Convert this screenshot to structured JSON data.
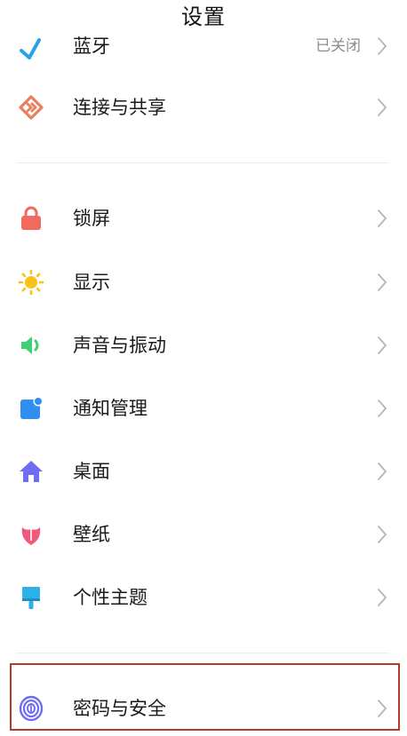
{
  "header": {
    "title": "设置"
  },
  "items": [
    {
      "label": "蓝牙",
      "value": "已关闭",
      "icon": "bluetooth-icon",
      "color": "#2aa3e6"
    },
    {
      "label": "连接与共享",
      "icon": "connection-share-icon",
      "color": "#e8805f"
    },
    {
      "label": "锁屏",
      "icon": "lock-icon",
      "color": "#f06a5e"
    },
    {
      "label": "显示",
      "icon": "sun-icon",
      "color": "#f7c21b"
    },
    {
      "label": "声音与振动",
      "icon": "speaker-icon",
      "color": "#3ecf77"
    },
    {
      "label": "通知管理",
      "icon": "notification-icon",
      "color": "#2e8ff0"
    },
    {
      "label": "桌面",
      "icon": "home-icon",
      "color": "#6f6ef0"
    },
    {
      "label": "壁纸",
      "icon": "tulip-icon",
      "color": "#ef5a7a"
    },
    {
      "label": "个性主题",
      "icon": "brush-icon",
      "color": "#2bb0e8"
    },
    {
      "label": "密码与安全",
      "icon": "fingerprint-icon",
      "color": "#6f6ef0"
    }
  ],
  "highlight_color": "#b33a2e"
}
